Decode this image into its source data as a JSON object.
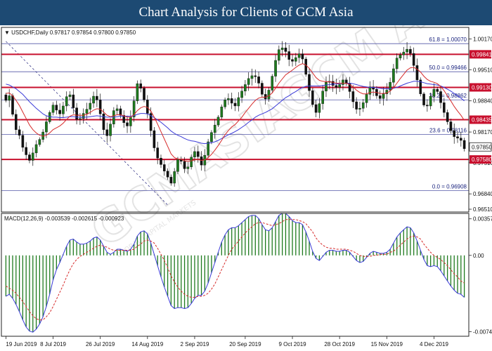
{
  "header": {
    "title": "Chart Analysis for Clients of GCM Asia"
  },
  "watermark": {
    "text": "GCMASIA",
    "subtext": "GCM ASIA",
    "tagline": "GLOBAL CAPITAL MARKETS"
  },
  "colors": {
    "header_bg": "#1d4a73",
    "bull": "#1e7a1e",
    "red_level": "#c8102e",
    "fib_line": "#5558a8",
    "ma_blue": "#3a3ad8",
    "ma_red": "#d62b2b",
    "price_tag": "#ffffff"
  },
  "chart_data": [
    {
      "type": "candlestick",
      "title": "USDCHF,Daily  0.97817 0.97854 0.97800 0.97850",
      "symbol": "USDCHF,Daily",
      "ohlc_header": [
        "0.97817",
        "0.97854",
        "0.97800",
        "0.97850"
      ],
      "ylim": [
        0.9645,
        1.0042
      ],
      "y_ticks": [
        "1.00170",
        "0.99510",
        "0.98840",
        "0.98170",
        "0.97510",
        "0.96840",
        "0.96510"
      ],
      "x_tick_labels": [
        "19 Jun 2019",
        "8 Jul 2019",
        "26 Jul 2019",
        "14 Aug 2019",
        "2 Sep 2019",
        "20 Sep 2019",
        "9 Oct 2019",
        "28 Oct 2019",
        "15 Nov 2019",
        "4 Dec 2019"
      ],
      "fib_levels": [
        {
          "label": "61.8 = 1.00070",
          "value": 1.0007
        },
        {
          "label": "50.0 = 0.99466",
          "value": 0.99466
        },
        {
          "label": "38.2 = 0.98862",
          "value": 0.98862
        },
        {
          "label": "23.6 = 0.98116",
          "value": 0.98116
        },
        {
          "label": "0.0 = 0.96908",
          "value": 0.96908
        }
      ],
      "resistance_levels": [
        {
          "label": "0.99841",
          "value": 0.99841
        },
        {
          "label": "0.99130",
          "value": 0.9913
        },
        {
          "label": "0.98435",
          "value": 0.98435
        },
        {
          "label": "0.97580",
          "value": 0.9758
        }
      ],
      "current_price": "0.97850",
      "closes": [
        0.9885,
        0.9895,
        0.9855,
        0.9822,
        0.981,
        0.9784,
        0.9768,
        0.9756,
        0.9772,
        0.979,
        0.9801,
        0.9817,
        0.9839,
        0.9859,
        0.9875,
        0.9864,
        0.9856,
        0.9873,
        0.9893,
        0.9897,
        0.9869,
        0.9844,
        0.9846,
        0.9857,
        0.9866,
        0.9879,
        0.9894,
        0.9886,
        0.9856,
        0.9822,
        0.9809,
        0.9834,
        0.9863,
        0.9867,
        0.9853,
        0.9837,
        0.983,
        0.9849,
        0.9884,
        0.9921,
        0.9911,
        0.9886,
        0.9857,
        0.982,
        0.9783,
        0.9761,
        0.9747,
        0.9733,
        0.972,
        0.9707,
        0.9732,
        0.9758,
        0.9754,
        0.9738,
        0.9742,
        0.9763,
        0.9775,
        0.9764,
        0.9746,
        0.9767,
        0.9796,
        0.9816,
        0.9832,
        0.9849,
        0.9871,
        0.9886,
        0.9889,
        0.9879,
        0.9873,
        0.9891,
        0.9905,
        0.9919,
        0.9932,
        0.9938,
        0.9936,
        0.9922,
        0.9898,
        0.9888,
        0.9907,
        0.9937,
        0.9971,
        0.9994,
        0.9998,
        0.999,
        0.9973,
        0.9969,
        0.9977,
        0.9985,
        0.9974,
        0.9941,
        0.9906,
        0.9876,
        0.9859,
        0.9878,
        0.9905,
        0.9924,
        0.9926,
        0.9917,
        0.9913,
        0.9919,
        0.9929,
        0.9921,
        0.9904,
        0.9882,
        0.9866,
        0.9868,
        0.988,
        0.9898,
        0.9914,
        0.9909,
        0.9895,
        0.9889,
        0.9899,
        0.9907,
        0.9924,
        0.9953,
        0.9976,
        0.9983,
        0.9989,
        0.9995,
        0.9986,
        0.996,
        0.9929,
        0.9899,
        0.9875,
        0.9873,
        0.9894,
        0.9909,
        0.9904,
        0.988,
        0.9859,
        0.9839,
        0.982,
        0.9807,
        0.9804,
        0.9799,
        0.9781
      ],
      "ma_blue": [
        0.992,
        0.9918,
        0.9914,
        0.991,
        0.9904,
        0.9898,
        0.989,
        0.9882,
        0.9875,
        0.9868,
        0.9862,
        0.9856,
        0.9852,
        0.985,
        0.9849,
        0.9849,
        0.9848,
        0.9848,
        0.9849,
        0.985,
        0.985,
        0.9849,
        0.9849,
        0.9849,
        0.9849,
        0.985,
        0.9851,
        0.9852,
        0.9851,
        0.985,
        0.9849,
        0.9849,
        0.9849,
        0.985,
        0.9851,
        0.9851,
        0.9851,
        0.9851,
        0.9852,
        0.9855,
        0.9857,
        0.9857,
        0.9856,
        0.9852,
        0.9848,
        0.9843,
        0.9838,
        0.9832,
        0.9826,
        0.9819,
        0.9814,
        0.981,
        0.9807,
        0.9803,
        0.98,
        0.9798,
        0.9797,
        0.9795,
        0.9793,
        0.9792,
        0.9793,
        0.9794,
        0.9796,
        0.9799,
        0.9803,
        0.9807,
        0.9811,
        0.9814,
        0.9818,
        0.9822,
        0.9827,
        0.9832,
        0.9838,
        0.9843,
        0.9849,
        0.9853,
        0.9856,
        0.9859,
        0.9863,
        0.9867,
        0.9873,
        0.9879,
        0.9885,
        0.9891,
        0.9895,
        0.99,
        0.9904,
        0.9909,
        0.9913,
        0.9915,
        0.9916,
        0.9916,
        0.9916,
        0.9916,
        0.9917,
        0.9918,
        0.9919,
        0.992,
        0.992,
        0.9921,
        0.9922,
        0.9922,
        0.9922,
        0.9921,
        0.9919,
        0.9917,
        0.9915,
        0.9914,
        0.9913,
        0.9913,
        0.9912,
        0.9911,
        0.991,
        0.991,
        0.991,
        0.9911,
        0.9913,
        0.9916,
        0.9919,
        0.9922,
        0.9924,
        0.9926,
        0.9926,
        0.9925,
        0.9923,
        0.9921,
        0.992,
        0.9919,
        0.9918,
        0.9916,
        0.9913,
        0.9909,
        0.9905,
        0.99,
        0.9895,
        0.989,
        0.9884
      ],
      "ma_red": [
        0.99,
        0.9901,
        0.9895,
        0.9885,
        0.9874,
        0.986,
        0.9846,
        0.9832,
        0.9822,
        0.9815,
        0.981,
        0.9808,
        0.981,
        0.9815,
        0.9822,
        0.9826,
        0.983,
        0.9836,
        0.9844,
        0.9851,
        0.9854,
        0.9853,
        0.9853,
        0.9853,
        0.9855,
        0.9859,
        0.9864,
        0.9867,
        0.9866,
        0.986,
        0.9853,
        0.985,
        0.9852,
        0.9854,
        0.9854,
        0.9852,
        0.9849,
        0.9849,
        0.9854,
        0.9863,
        0.9869,
        0.9872,
        0.987,
        0.9862,
        0.9849,
        0.9834,
        0.9818,
        0.9802,
        0.9786,
        0.977,
        0.9762,
        0.9759,
        0.9758,
        0.9755,
        0.9754,
        0.9755,
        0.9757,
        0.9758,
        0.9756,
        0.9757,
        0.9762,
        0.9769,
        0.9778,
        0.9788,
        0.9799,
        0.9811,
        0.982,
        0.9828,
        0.9833,
        0.9841,
        0.9849,
        0.9859,
        0.9868,
        0.9877,
        0.9885,
        0.989,
        0.9892,
        0.9892,
        0.9895,
        0.9901,
        0.9911,
        0.9922,
        0.9931,
        0.994,
        0.9945,
        0.995,
        0.9956,
        0.9961,
        0.9964,
        0.9961,
        0.9954,
        0.9944,
        0.9934,
        0.9928,
        0.9926,
        0.9925,
        0.9925,
        0.9924,
        0.9922,
        0.9922,
        0.9922,
        0.9922,
        0.9919,
        0.9914,
        0.9907,
        0.9902,
        0.9899,
        0.9899,
        0.9902,
        0.9903,
        0.9902,
        0.99,
        0.99,
        0.9901,
        0.9905,
        0.9912,
        0.9922,
        0.9932,
        0.9941,
        0.995,
        0.9955,
        0.9956,
        0.9952,
        0.9946,
        0.9937,
        0.993,
        0.9926,
        0.9924,
        0.9921,
        0.9915,
        0.9906,
        0.9895,
        0.9884,
        0.9872,
        0.9862,
        0.9853,
        0.9842
      ]
    },
    {
      "type": "macd",
      "title": "MACD(12,26,9) -0.003539 -0.002615 -0.000923",
      "label": "MACD(12,26,9)",
      "values_header": [
        "-0.003539",
        "-0.002615",
        "-0.000923"
      ],
      "ylim": [
        -0.0079,
        0.0041
      ],
      "y_ticks": [
        "0.00357",
        "0.00",
        "-0.00746"
      ],
      "macd": [
        -0.004,
        -0.0038,
        -0.0042,
        -0.0048,
        -0.0055,
        -0.0063,
        -0.007,
        -0.0074,
        -0.0075,
        -0.0072,
        -0.0067,
        -0.006,
        -0.005,
        -0.0038,
        -0.0024,
        -0.0014,
        -0.0007,
        0.0001,
        0.0009,
        0.0015,
        0.0016,
        0.0013,
        0.0011,
        0.0011,
        0.0012,
        0.0014,
        0.0017,
        0.0018,
        0.0015,
        0.0009,
        0.0003,
        0.0001,
        0.0003,
        0.0006,
        0.0006,
        0.0005,
        0.0004,
        0.0006,
        0.0011,
        0.0019,
        0.0023,
        0.0024,
        0.0021,
        0.0012,
        0.0001,
        -0.001,
        -0.0021,
        -0.0031,
        -0.004,
        -0.0049,
        -0.0052,
        -0.0051,
        -0.0051,
        -0.0052,
        -0.0051,
        -0.0047,
        -0.0042,
        -0.0039,
        -0.0039,
        -0.0035,
        -0.0027,
        -0.0017,
        -0.0007,
        0.0003,
        0.0013,
        0.002,
        0.0025,
        0.0027,
        0.0027,
        0.0029,
        0.0032,
        0.0035,
        0.0038,
        0.0039,
        0.0039,
        0.0036,
        0.003,
        0.0025,
        0.0024,
        0.0027,
        0.0033,
        0.0039,
        0.0041,
        0.0041,
        0.0038,
        0.0034,
        0.0032,
        0.0032,
        0.003,
        0.0023,
        0.0014,
        0.0004,
        -0.0003,
        -0.0005,
        -0.0001,
        0.0003,
        0.0005,
        0.0005,
        0.0004,
        0.0004,
        0.0005,
        0.0005,
        0.0003,
        -0.0001,
        -0.0005,
        -0.0007,
        -0.0006,
        -0.0002,
        0.0002,
        0.0004,
        0.0003,
        0.0002,
        0.0002,
        0.0003,
        0.0006,
        0.0012,
        0.0018,
        0.0022,
        0.0025,
        0.0028,
        0.0027,
        0.0022,
        0.0014,
        0.0005,
        -0.0004,
        -0.001,
        -0.0011,
        -0.001,
        -0.0011,
        -0.0015,
        -0.002,
        -0.0025,
        -0.003,
        -0.0034,
        -0.0037,
        -0.0038,
        -0.0041
      ],
      "signal": [
        -0.003,
        -0.0032,
        -0.0034,
        -0.0037,
        -0.0041,
        -0.0045,
        -0.005,
        -0.0055,
        -0.0059,
        -0.0062,
        -0.0063,
        -0.0063,
        -0.006,
        -0.0056,
        -0.005,
        -0.0043,
        -0.0036,
        -0.0029,
        -0.0021,
        -0.0014,
        -0.0008,
        -0.0004,
        -0.0001,
        0.0001,
        0.0003,
        0.0005,
        0.0007,
        0.0009,
        0.001,
        0.0009,
        0.0008,
        0.0006,
        0.0005,
        0.0005,
        0.0005,
        0.0005,
        0.0005,
        0.0005,
        0.0006,
        0.0009,
        0.0011,
        0.0014,
        0.0015,
        0.0014,
        0.0012,
        0.0007,
        0.0001,
        -0.0005,
        -0.0012,
        -0.002,
        -0.0026,
        -0.0031,
        -0.0035,
        -0.0038,
        -0.004,
        -0.0041,
        -0.0041,
        -0.004,
        -0.004,
        -0.0039,
        -0.0037,
        -0.0033,
        -0.0028,
        -0.0021,
        -0.0014,
        -0.0007,
        0.0,
        0.0006,
        0.001,
        0.0014,
        0.0018,
        0.0022,
        0.0025,
        0.0028,
        0.0031,
        0.0032,
        0.0032,
        0.0031,
        0.003,
        0.0029,
        0.003,
        0.0031,
        0.0033,
        0.0035,
        0.0035,
        0.0035,
        0.0035,
        0.0034,
        0.0033,
        0.0031,
        0.0027,
        0.0023,
        0.0017,
        0.0013,
        0.001,
        0.0008,
        0.0007,
        0.0007,
        0.0006,
        0.0006,
        0.0006,
        0.0006,
        0.0005,
        0.0004,
        0.0002,
        0.0,
        -0.0001,
        -0.0001,
        -0.0001,
        0.0,
        0.0,
        0.0001,
        0.0001,
        0.0001,
        0.0003,
        0.0004,
        0.0007,
        0.001,
        0.0013,
        0.0016,
        0.0018,
        0.0019,
        0.0018,
        0.0016,
        0.0011,
        0.0007,
        0.0003,
        0.0,
        -0.0002,
        -0.0004,
        -0.0007,
        -0.001,
        -0.0014,
        -0.0018,
        -0.0021,
        -0.0025,
        -0.0027
      ]
    }
  ]
}
